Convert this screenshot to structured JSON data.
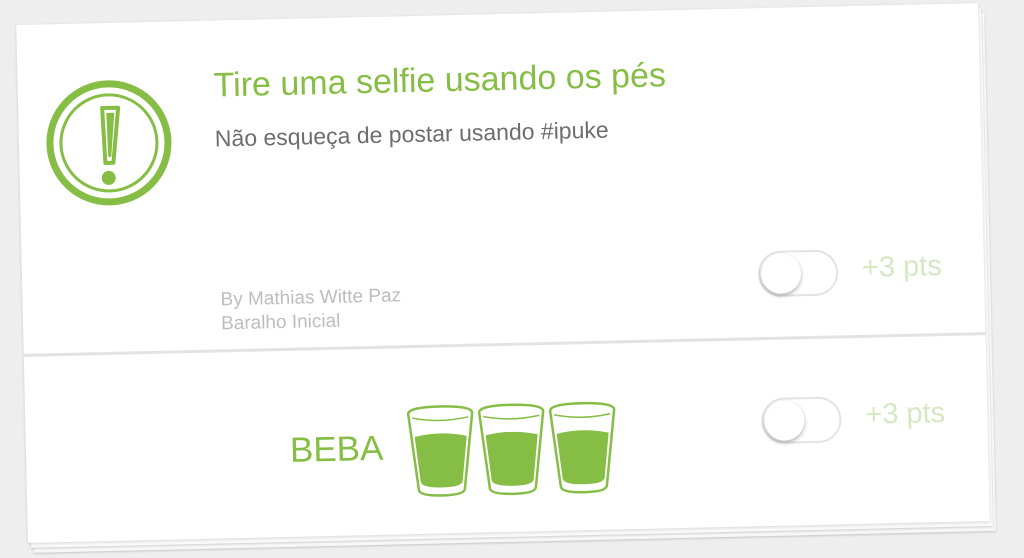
{
  "challenge_card": {
    "title": "Tire uma selfie usando os pés",
    "subtitle": "Não esqueça de postar usando #ipuke",
    "author": "By Mathias Witte Paz",
    "deck": "Baralho Inicial",
    "points": "+3 pts",
    "toggle_on": false,
    "icon": "exclamation-circle-icon"
  },
  "drink_card": {
    "label": "BEBA",
    "shot_count": 3,
    "points": "+3 pts",
    "toggle_on": false,
    "icon": "shot-glass-icon"
  },
  "colors": {
    "accent_green": "#86bd45",
    "points_green_faded": "#d6e8c3",
    "subtitle_gray": "#6d6d6d",
    "meta_gray": "#bdbdbd",
    "background": "#eeeeee"
  }
}
